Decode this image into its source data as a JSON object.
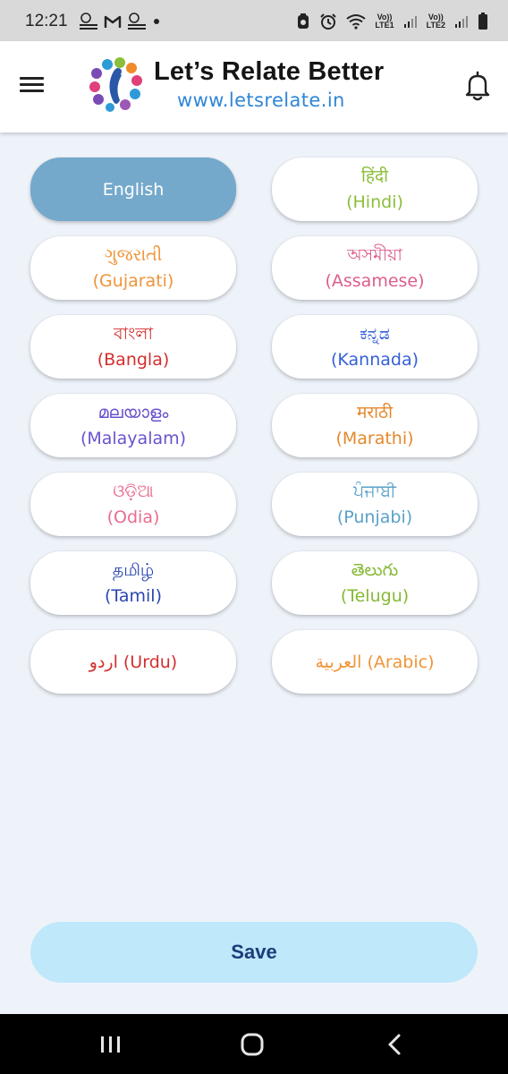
{
  "status_bar": {
    "time": "12:21",
    "left_icons": [
      "whatsapp-business-icon",
      "gmail-icon",
      "whatsapp-business-icon",
      "dot-icon"
    ],
    "right_icons": [
      "nfc-icon",
      "alarm-icon",
      "wifi-icon",
      "signal-icon",
      "signal-icon",
      "battery-icon"
    ],
    "sim1_label_top": "Vo))",
    "sim1_label_bottom": "LTE1",
    "sim2_label_top": "Vo))",
    "sim2_label_bottom": "LTE2"
  },
  "header": {
    "title": "Let’s Relate Better",
    "url": "www.letsrelate.in"
  },
  "languages": [
    {
      "native": "English",
      "english": "",
      "color": "#ffffff",
      "selected": true
    },
    {
      "native": "हिंदी",
      "english": "(Hindi)",
      "color": "#8bbe3a",
      "selected": false
    },
    {
      "native": "ગુજરાતી",
      "english": "(Gujarati)",
      "color": "#ef9438",
      "selected": false
    },
    {
      "native": "অসমীয়া",
      "english": "(Assamese)",
      "color": "#dc5d8c",
      "selected": false
    },
    {
      "native": "বাংলা",
      "english": "(Bangla)",
      "color": "#d42e2e",
      "selected": false
    },
    {
      "native": "ಕನ್ನಡ",
      "english": "(Kannada)",
      "color": "#3560d8",
      "selected": false
    },
    {
      "native": "മലയാളം",
      "english": "(Malayalam)",
      "color": "#6a52cf",
      "selected": false
    },
    {
      "native": "मराठी",
      "english": "(Marathi)",
      "color": "#e5882c",
      "selected": false
    },
    {
      "native": "ଓଡ଼ିଆ",
      "english": "(Odia)",
      "color": "#e96c8f",
      "selected": false
    },
    {
      "native": "ਪੰਜਾਬੀ",
      "english": "(Punjabi)",
      "color": "#5aa1c8",
      "selected": false
    },
    {
      "native": "தமிழ்",
      "english": "(Tamil)",
      "color": "#2946b0",
      "selected": false
    },
    {
      "native": "తెలుగు",
      "english": "(Telugu)",
      "color": "#86b935",
      "selected": false
    },
    {
      "native": "اردو (Urdu)",
      "english": "",
      "color": "#d42e2e",
      "selected": false
    },
    {
      "native": "العربية (Arabic)",
      "english": "",
      "color": "#ef9438",
      "selected": false
    }
  ],
  "save_label": "Save",
  "nav_bar": {
    "icons": [
      "recent-apps-icon",
      "home-icon",
      "back-icon"
    ]
  }
}
